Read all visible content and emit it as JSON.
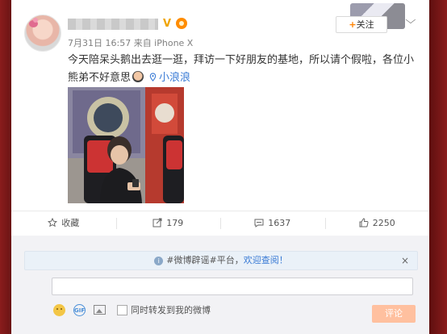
{
  "post": {
    "username": "██████████",
    "timestamp": "7月31日 16:57 来自 iPhone X",
    "text_part1": "今天陪呆头鹅出去逛一逛，拜访一下好朋友的基地，所以请个假啦，各位小熊弟",
    "text_part2": "不好意思",
    "location": "小浪浪",
    "follow_label": "关注",
    "follow_plus": "+"
  },
  "actions": {
    "favorite_label": "收藏",
    "repost_count": "179",
    "comment_count": "1637",
    "like_count": "2250"
  },
  "comment": {
    "notice_prefix": "#微博辟谣#平台，",
    "notice_link": "欢迎查阅！",
    "notice_close": "×",
    "input_placeholder": "",
    "repost_checkbox_label": "同时转发到我的微博",
    "submit_label": "评论",
    "gif_label": "GIF"
  },
  "colors": {
    "accent_orange": "#ff8200",
    "link_blue": "#3a7bd5",
    "submit_bg": "#ffc09f"
  }
}
